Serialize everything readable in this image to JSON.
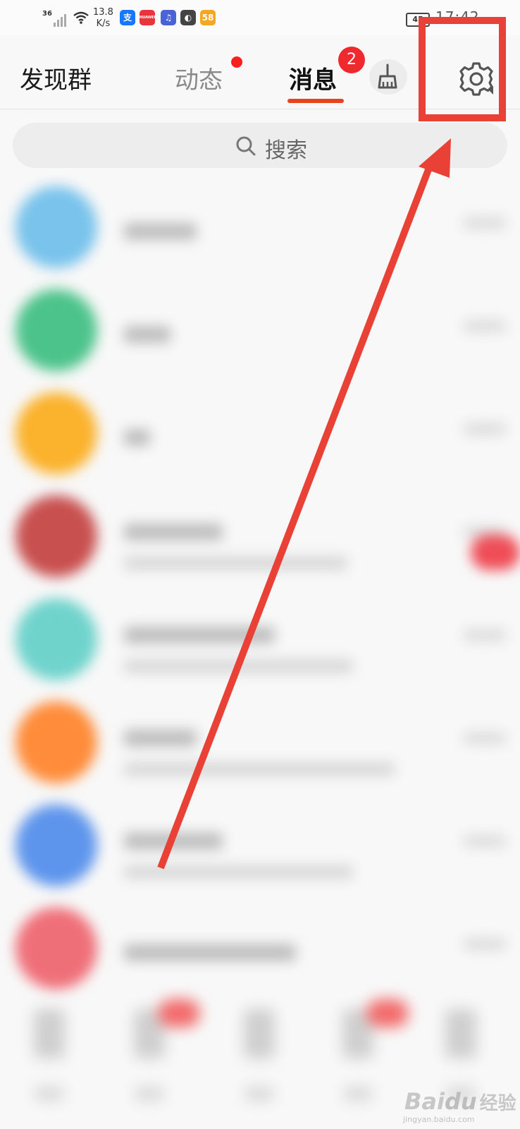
{
  "status_bar": {
    "network": "36",
    "speed_value": "13.8",
    "speed_unit": "K/s",
    "battery": "45",
    "time": "17:42",
    "app_icons": [
      {
        "name": "alipay-icon",
        "glyph": "支",
        "color": "#1677ff"
      },
      {
        "name": "huawei-icon",
        "glyph": "HUAWEI",
        "color": "#e8343a"
      },
      {
        "name": "music-icon",
        "glyph": "♫",
        "color": "#4a63d6"
      },
      {
        "name": "browser-icon",
        "glyph": "◐",
        "color": "#444444"
      },
      {
        "name": "58-app-icon",
        "glyph": "58",
        "color": "#f5a623"
      }
    ]
  },
  "header": {
    "title": "发现群",
    "tabs": [
      {
        "label": "动态",
        "active": false,
        "has_dot": true
      },
      {
        "label": "消息",
        "active": true,
        "badge": "2"
      }
    ],
    "accent_color": "#e8431c"
  },
  "search": {
    "label": "搜索"
  },
  "conversations": [
    {
      "avatar_color": "#79c3ec",
      "line1_fraction": 0.14,
      "line2_fraction": 0
    },
    {
      "avatar_color": "#4cc38a",
      "line1_fraction": 0.09,
      "line2_fraction": 0
    },
    {
      "avatar_color": "#fbb22c",
      "line1_fraction": 0.05,
      "line2_fraction": 0
    },
    {
      "avatar_color": "#c8504f",
      "line1_fraction": 0.19,
      "line2_fraction": 0.43,
      "unread": true
    },
    {
      "avatar_color": "#6fd3cc",
      "line1_fraction": 0.29,
      "line2_fraction": 0.44
    },
    {
      "avatar_color": "#ff8c3a",
      "line1_fraction": 0.14,
      "line2_fraction": 0.52
    },
    {
      "avatar_color": "#5e95ec",
      "line1_fraction": 0.19,
      "line2_fraction": 0.44
    },
    {
      "avatar_color": "#ef6f78",
      "line1_fraction": 0.33,
      "line2_fraction": 0
    }
  ],
  "bottom_nav": {
    "item_count_note": "",
    "dot_color": "#f26a6a"
  },
  "annotation": {
    "color": "#e94136"
  },
  "watermark": {
    "main": "Bai",
    "accent": "du",
    "cn": "经验",
    "sub": "jingyan.baidu.com"
  }
}
